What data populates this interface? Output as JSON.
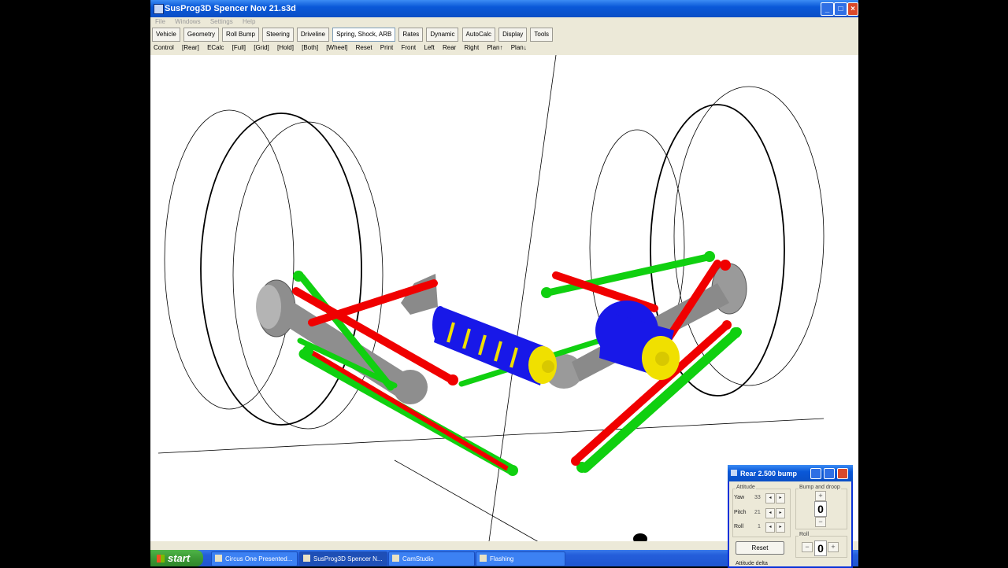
{
  "window": {
    "title": "SusProg3D Spencer Nov 21.s3d",
    "controls": [
      "_",
      "□",
      "×"
    ]
  },
  "menu": [
    "File",
    "Windows",
    "Settings",
    "Help"
  ],
  "toolbar_tabs": [
    "Vehicle",
    "Geometry",
    "Roll Bump",
    "Steering",
    "Driveline",
    "Spring, Shock, ARB",
    "Rates",
    "Dynamic",
    "AutoCalc",
    "Display",
    "Tools"
  ],
  "active_tab": "Spring, Shock, ARB",
  "view_controls": [
    "Control",
    "[Rear]",
    "ECalc",
    "[Full]",
    "[Grid]",
    "[Hold]",
    "[Both]",
    "[Wheel]",
    "Reset",
    "Print",
    "Front",
    "Left",
    "Rear",
    "Right",
    "Plan↑",
    "Plan↓"
  ],
  "dialog": {
    "title": "Rear 2.500 bump",
    "attitude": {
      "label": "Attitude",
      "yaw": {
        "label": "Yaw",
        "value": "33"
      },
      "pitch": {
        "label": "Pitch",
        "value": "21"
      },
      "roll": {
        "label": "Roll",
        "value": "1"
      }
    },
    "bump_and_droop": {
      "label": "Bump and droop",
      "value": "0",
      "plus": "+",
      "minus": "−"
    },
    "roll_group": {
      "label": "Roll",
      "value": "0",
      "minus": "−",
      "plus": "+"
    },
    "reset_label": "Reset",
    "attitude_delta_label": "Attitude delta"
  },
  "taskbar": {
    "start_label": "start",
    "items": [
      {
        "label": "Circus One Presented...",
        "active": false
      },
      {
        "label": "SusProg3D Spencer N...",
        "active": true
      },
      {
        "label": "CamStudio",
        "active": false
      },
      {
        "label": "Flashing",
        "active": false
      }
    ]
  },
  "colors": {
    "link_green": "#10d010",
    "link_red": "#f00000",
    "spring_blue": "#1818e8",
    "shock_yellow": "#f0e000",
    "metal_gray": "#8a8a8a"
  }
}
